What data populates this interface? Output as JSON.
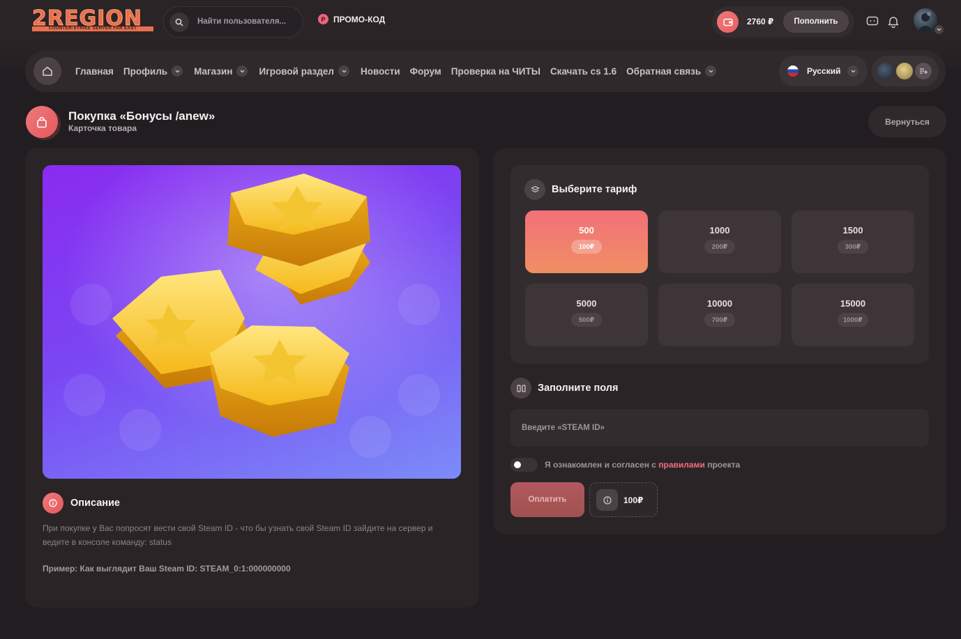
{
  "brand": {
    "logo_text": "2REGION",
    "logo_sub": "COUNTER-STRIKE SERVER FAR EAST"
  },
  "header": {
    "search_placeholder": "Найти пользователя...",
    "promo_label": "ПРОМО-КОД",
    "promo_icon_letter": "P",
    "balance": "2760 ₽",
    "topup_label": "Пополнить"
  },
  "nav": {
    "links": [
      {
        "label": "Главная",
        "dropdown": false
      },
      {
        "label": "Профиль",
        "dropdown": true
      },
      {
        "label": "Магазин",
        "dropdown": true
      },
      {
        "label": "Игровой раздел",
        "dropdown": true
      },
      {
        "label": "Новости",
        "dropdown": false
      },
      {
        "label": "Форум",
        "dropdown": false
      },
      {
        "label": "Проверка на ЧИТЫ",
        "dropdown": false
      },
      {
        "label": "Скачать cs 1.6",
        "dropdown": false
      },
      {
        "label": "Обратная связь",
        "dropdown": true
      }
    ],
    "language": "Русский"
  },
  "page": {
    "title": "Покупка «Бонусы /anew»",
    "subtitle": "Карточка товара",
    "back_label": "Вернуться"
  },
  "description": {
    "title": "Описание",
    "text": "При покупке у Вас попросят вести свой Steam ID - что бы узнать свой Steam ID зайдите на сервер и ведите в консоле команду: status",
    "example": "Пример: Как выглядит Ваш Steam ID: STEAM_0:1:000000000"
  },
  "tariff": {
    "title": "Выберите тариф",
    "options": [
      {
        "amount": "500",
        "price": "100₽",
        "active": true
      },
      {
        "amount": "1000",
        "price": "200₽",
        "active": false
      },
      {
        "amount": "1500",
        "price": "300₽",
        "active": false
      },
      {
        "amount": "5000",
        "price": "500₽",
        "active": false
      },
      {
        "amount": "10000",
        "price": "700₽",
        "active": false
      },
      {
        "amount": "15000",
        "price": "1000₽",
        "active": false
      }
    ]
  },
  "fields": {
    "title": "Заполните поля",
    "steam_placeholder": "Введите «STEAM ID»",
    "steam_value": ""
  },
  "agreement": {
    "before": "Я ознакомлен и согласен с ",
    "link": "правилами",
    "after": " проекта",
    "checked": false
  },
  "checkout": {
    "pay_label": "Оплатить",
    "total": "100₽"
  },
  "colors": {
    "accent": "#f16f7c",
    "accent_gradient_end": "#ef8f63",
    "background": "#221d20",
    "card": "#2a2427"
  }
}
